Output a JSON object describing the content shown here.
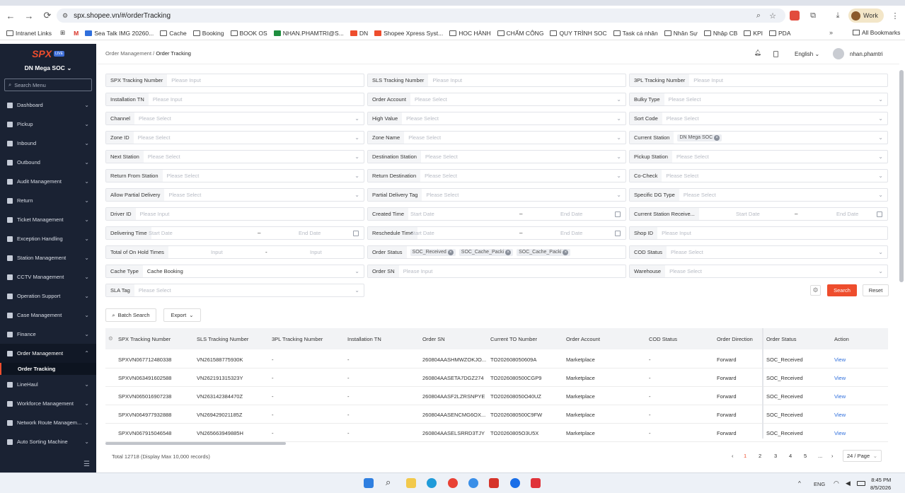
{
  "browser": {
    "url": "spx.shopee.vn/#/orderTracking",
    "profile": "Work",
    "bookmarks": [
      "Intranet Links",
      "",
      "",
      "Sea Talk IMG 20260...",
      "Cache",
      "Booking",
      "BOOK OS",
      "NHAN.PHAMTRI@S...",
      "DN",
      "Shopee Xpress Syst...",
      "HOC HÀNH",
      "CHẤM CÔNG",
      "QUY TRÌNH SOC",
      "Task cá nhân",
      "Nhân Sự",
      "Nhập CB",
      "KPI",
      "PDA"
    ],
    "all_bookmarks": "All Bookmarks"
  },
  "sidebar": {
    "logo": "SPX",
    "logo_badge": "LIVE",
    "station": "DN Mega SOC",
    "search_placeholder": "Search Menu",
    "items": [
      {
        "label": "Dashboard"
      },
      {
        "label": "Pickup"
      },
      {
        "label": "Inbound"
      },
      {
        "label": "Outbound"
      },
      {
        "label": "Audit Management"
      },
      {
        "label": "Return"
      },
      {
        "label": "Ticket Management"
      },
      {
        "label": "Exception Handling"
      },
      {
        "label": "Station Management"
      },
      {
        "label": "CCTV Management"
      },
      {
        "label": "Operation Support"
      },
      {
        "label": "Case Management"
      },
      {
        "label": "Finance"
      },
      {
        "label": "Order Management"
      },
      {
        "label": "LineHaul"
      },
      {
        "label": "Workforce Management"
      },
      {
        "label": "Network Route Managem..."
      },
      {
        "label": "Auto Sorting Machine"
      }
    ],
    "active_sub": "Order Tracking"
  },
  "header": {
    "crumb_parent": "Order Management",
    "crumb_current": "Order Tracking",
    "language": "English",
    "user": "nhan.phamtri"
  },
  "filters": {
    "spx_tn": "SPX Tracking Number",
    "sls_tn": "SLS Tracking Number",
    "tpl_tn": "3PL Tracking Number",
    "installation_tn": "Installation TN",
    "order_account": "Order Account",
    "bulky_type": "Bulky Type",
    "channel": "Channel",
    "high_value": "High Value",
    "sort_code": "Sort Code",
    "zone_id": "Zone ID",
    "zone_name": "Zone Name",
    "current_station": "Current Station",
    "current_station_tag": "DN Mega SOC",
    "next_station": "Next Station",
    "destination_station": "Destination Station",
    "pickup_station": "Pickup Station",
    "return_from_station": "Return From Station",
    "return_destination": "Return Destination",
    "co_check": "Co-Check",
    "allow_partial": "Allow Partial Delivery",
    "partial_tag": "Partial Delivery Tag",
    "specific_dg": "Specific DG Type",
    "driver_id": "Driver ID",
    "created_time": "Created Time",
    "current_station_receive": "Current Station Receive...",
    "delivering_time": "Delivering Time",
    "reschedule_time": "Reschedule Time",
    "shop_id": "Shop ID",
    "on_hold": "Total of On Hold Times",
    "order_status": "Order Status",
    "order_status_tags": [
      "SOC_Received",
      "SOC_Cache_Packi",
      "SOC_Cache_Packi"
    ],
    "cod_status": "COD Status",
    "cache_type": "Cache Type",
    "cache_type_value": "Cache Booking",
    "order_sn": "Order SN",
    "warehouse": "Warehouse",
    "sla_tag": "SLA Tag",
    "ph_input": "Please Input",
    "ph_select": "Please Select",
    "ph_start": "Start Date",
    "ph_end": "End Date",
    "ph_input_short": "Input",
    "range_sep": "–",
    "range_sep2": "-"
  },
  "actions": {
    "search": "Search",
    "reset": "Reset",
    "batch_search": "Batch Search",
    "export": "Export"
  },
  "table": {
    "columns": [
      "SPX Tracking Number",
      "SLS Tracking Number",
      "3PL Tracking Number",
      "Installation TN",
      "Order SN",
      "Current TO Number",
      "Order Account",
      "COD Status",
      "Order Direction",
      "Order Status",
      "Action"
    ],
    "rows": [
      [
        "SPXVN067712480338",
        "VN261588775930K",
        "-",
        "-",
        "260804AASHMWZOKJO...",
        "TO202608050609A",
        "Marketplace",
        "-",
        "Forward",
        "SOC_Received",
        "View"
      ],
      [
        "SPXVN063491602588",
        "VN262191315323Y",
        "-",
        "-",
        "260804AASETA7DGZ274",
        "TO2026080500CGP9",
        "Marketplace",
        "-",
        "Forward",
        "SOC_Received",
        "View"
      ],
      [
        "SPXVN065016907238",
        "VN263142384470Z",
        "-",
        "-",
        "260804AASF2LZRSNPYE",
        "TO202608050O40UZ",
        "Marketplace",
        "-",
        "Forward",
        "SOC_Received",
        "View"
      ],
      [
        "SPXVN064977932888",
        "VN269429021185Z",
        "-",
        "-",
        "260804AASENCMG6OX...",
        "TO2026080500C9FW",
        "Marketplace",
        "-",
        "Forward",
        "SOC_Received",
        "View"
      ],
      [
        "SPXVN067915046548",
        "VN265663949885H",
        "-",
        "-",
        "260804AASELSRRD3TJY",
        "TO20260805O3U5X",
        "Marketplace",
        "-",
        "Forward",
        "SOC_Received",
        "View"
      ]
    ]
  },
  "footer": {
    "total": "Total 12718 (Display Max 10,000 records)",
    "pages": [
      "1",
      "2",
      "3",
      "4",
      "5",
      "..."
    ],
    "page_size": "24 / Page"
  },
  "taskbar": {
    "lang": "ENG",
    "time": "8:45 PM",
    "date": "8/5/2026"
  },
  "colors": {
    "accent": "#ee4d2d",
    "sidebar": "#1a2233",
    "link": "#2f6fdc"
  }
}
